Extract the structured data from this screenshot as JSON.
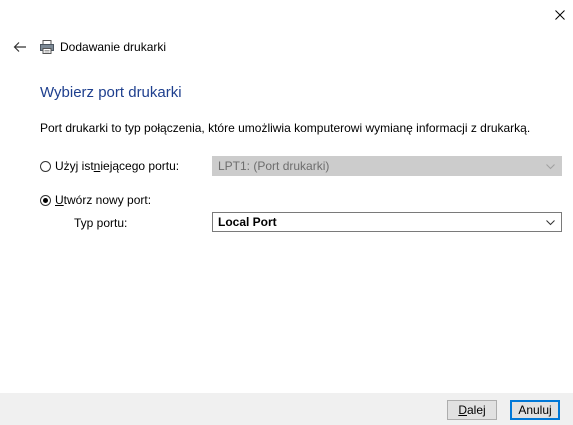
{
  "window": {
    "title": "Dodawanie drukarki",
    "close_icon": "close-icon",
    "back_icon": "back-arrow-icon",
    "app_icon": "printer-icon"
  },
  "page": {
    "heading": "Wybierz port drukarki",
    "description": "Port drukarki to typ połączenia, które umożliwia komputerowi wymianę informacji z drukarką."
  },
  "options": {
    "existing_port": {
      "label_pre": "Użyj ist",
      "label_underlined": "n",
      "label_post": "iejącego portu:",
      "selected": false,
      "value": "LPT1: (Port drukarki)"
    },
    "new_port": {
      "label_underlined": "U",
      "label_post": "twórz nowy port:",
      "selected": true,
      "type_label": "Typ portu:",
      "type_value": "Local Port"
    }
  },
  "buttons": {
    "next_underlined": "D",
    "next_rest": "alej",
    "cancel": "Anuluj"
  },
  "colors": {
    "heading": "#1e3f8e",
    "default_button_border": "#0078d7",
    "footer_bg": "#f0f0f0"
  }
}
